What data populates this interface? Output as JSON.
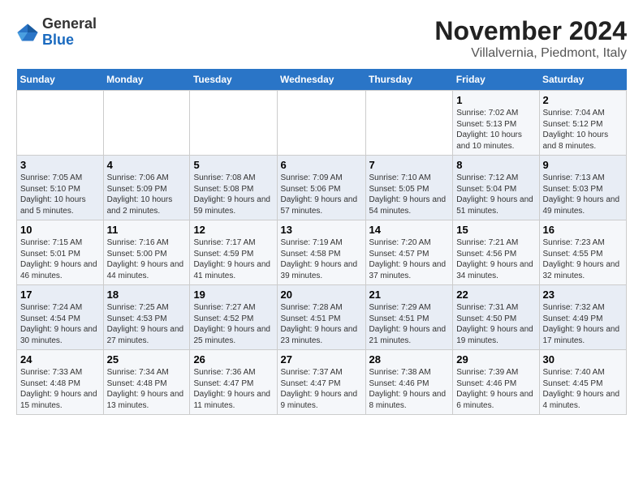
{
  "logo": {
    "line1": "General",
    "line2": "Blue"
  },
  "title": "November 2024",
  "subtitle": "Villalvernia, Piedmont, Italy",
  "days_header": [
    "Sunday",
    "Monday",
    "Tuesday",
    "Wednesday",
    "Thursday",
    "Friday",
    "Saturday"
  ],
  "weeks": [
    [
      {
        "day": "",
        "info": ""
      },
      {
        "day": "",
        "info": ""
      },
      {
        "day": "",
        "info": ""
      },
      {
        "day": "",
        "info": ""
      },
      {
        "day": "",
        "info": ""
      },
      {
        "day": "1",
        "info": "Sunrise: 7:02 AM\nSunset: 5:13 PM\nDaylight: 10 hours and 10 minutes."
      },
      {
        "day": "2",
        "info": "Sunrise: 7:04 AM\nSunset: 5:12 PM\nDaylight: 10 hours and 8 minutes."
      }
    ],
    [
      {
        "day": "3",
        "info": "Sunrise: 7:05 AM\nSunset: 5:10 PM\nDaylight: 10 hours and 5 minutes."
      },
      {
        "day": "4",
        "info": "Sunrise: 7:06 AM\nSunset: 5:09 PM\nDaylight: 10 hours and 2 minutes."
      },
      {
        "day": "5",
        "info": "Sunrise: 7:08 AM\nSunset: 5:08 PM\nDaylight: 9 hours and 59 minutes."
      },
      {
        "day": "6",
        "info": "Sunrise: 7:09 AM\nSunset: 5:06 PM\nDaylight: 9 hours and 57 minutes."
      },
      {
        "day": "7",
        "info": "Sunrise: 7:10 AM\nSunset: 5:05 PM\nDaylight: 9 hours and 54 minutes."
      },
      {
        "day": "8",
        "info": "Sunrise: 7:12 AM\nSunset: 5:04 PM\nDaylight: 9 hours and 51 minutes."
      },
      {
        "day": "9",
        "info": "Sunrise: 7:13 AM\nSunset: 5:03 PM\nDaylight: 9 hours and 49 minutes."
      }
    ],
    [
      {
        "day": "10",
        "info": "Sunrise: 7:15 AM\nSunset: 5:01 PM\nDaylight: 9 hours and 46 minutes."
      },
      {
        "day": "11",
        "info": "Sunrise: 7:16 AM\nSunset: 5:00 PM\nDaylight: 9 hours and 44 minutes."
      },
      {
        "day": "12",
        "info": "Sunrise: 7:17 AM\nSunset: 4:59 PM\nDaylight: 9 hours and 41 minutes."
      },
      {
        "day": "13",
        "info": "Sunrise: 7:19 AM\nSunset: 4:58 PM\nDaylight: 9 hours and 39 minutes."
      },
      {
        "day": "14",
        "info": "Sunrise: 7:20 AM\nSunset: 4:57 PM\nDaylight: 9 hours and 37 minutes."
      },
      {
        "day": "15",
        "info": "Sunrise: 7:21 AM\nSunset: 4:56 PM\nDaylight: 9 hours and 34 minutes."
      },
      {
        "day": "16",
        "info": "Sunrise: 7:23 AM\nSunset: 4:55 PM\nDaylight: 9 hours and 32 minutes."
      }
    ],
    [
      {
        "day": "17",
        "info": "Sunrise: 7:24 AM\nSunset: 4:54 PM\nDaylight: 9 hours and 30 minutes."
      },
      {
        "day": "18",
        "info": "Sunrise: 7:25 AM\nSunset: 4:53 PM\nDaylight: 9 hours and 27 minutes."
      },
      {
        "day": "19",
        "info": "Sunrise: 7:27 AM\nSunset: 4:52 PM\nDaylight: 9 hours and 25 minutes."
      },
      {
        "day": "20",
        "info": "Sunrise: 7:28 AM\nSunset: 4:51 PM\nDaylight: 9 hours and 23 minutes."
      },
      {
        "day": "21",
        "info": "Sunrise: 7:29 AM\nSunset: 4:51 PM\nDaylight: 9 hours and 21 minutes."
      },
      {
        "day": "22",
        "info": "Sunrise: 7:31 AM\nSunset: 4:50 PM\nDaylight: 9 hours and 19 minutes."
      },
      {
        "day": "23",
        "info": "Sunrise: 7:32 AM\nSunset: 4:49 PM\nDaylight: 9 hours and 17 minutes."
      }
    ],
    [
      {
        "day": "24",
        "info": "Sunrise: 7:33 AM\nSunset: 4:48 PM\nDaylight: 9 hours and 15 minutes."
      },
      {
        "day": "25",
        "info": "Sunrise: 7:34 AM\nSunset: 4:48 PM\nDaylight: 9 hours and 13 minutes."
      },
      {
        "day": "26",
        "info": "Sunrise: 7:36 AM\nSunset: 4:47 PM\nDaylight: 9 hours and 11 minutes."
      },
      {
        "day": "27",
        "info": "Sunrise: 7:37 AM\nSunset: 4:47 PM\nDaylight: 9 hours and 9 minutes."
      },
      {
        "day": "28",
        "info": "Sunrise: 7:38 AM\nSunset: 4:46 PM\nDaylight: 9 hours and 8 minutes."
      },
      {
        "day": "29",
        "info": "Sunrise: 7:39 AM\nSunset: 4:46 PM\nDaylight: 9 hours and 6 minutes."
      },
      {
        "day": "30",
        "info": "Sunrise: 7:40 AM\nSunset: 4:45 PM\nDaylight: 9 hours and 4 minutes."
      }
    ]
  ]
}
